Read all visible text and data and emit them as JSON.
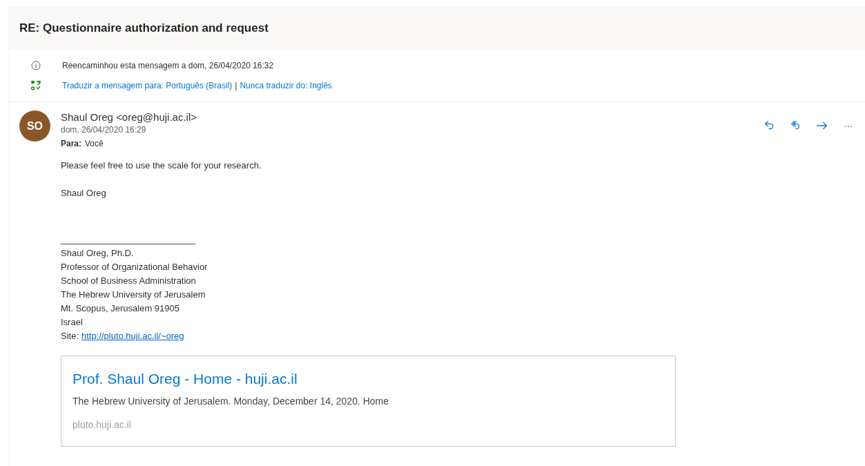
{
  "subject": "RE: Questionnaire authorization and request",
  "notices": [
    {
      "kind": "info",
      "parts": [
        {
          "text": "Reencaminhou esta mensagem a dom, 26/04/2020 16:32",
          "link": false
        }
      ]
    },
    {
      "kind": "translate",
      "parts": [
        {
          "text": "Traduzir a mensagem para: Português (Brasil)",
          "link": true
        },
        {
          "text": "|",
          "link": false
        },
        {
          "text": "Nunca traduzir do: Inglês",
          "link": true
        }
      ]
    }
  ],
  "message": {
    "avatar_initials": "SO",
    "sender": "Shaul Oreg <oreg@huji.ac.il>",
    "date": "dom, 26/04/2020 16:29",
    "to_label": "Para:",
    "to": "Você",
    "actions": [
      {
        "kind": "reply"
      },
      {
        "kind": "reply_all"
      },
      {
        "kind": "forward"
      },
      {
        "kind": "more",
        "text": "···"
      }
    ],
    "paragraphs": [
      "Please feel free to use the scale for your research.",
      "Shaul Oreg"
    ],
    "signature": [
      "___________________________",
      "Shaul Oreg, Ph.D.",
      "Professor of Organizational Behavior",
      "School of Business Administration",
      "The Hebrew University of Jerusalem",
      "Mt. Scopus, Jerusalem 91905",
      "Israel"
    ],
    "site_label": "Site:",
    "site_url": "http://pluto.huji.ac.il/~oreg",
    "preview": {
      "title": "Prof. Shaul Oreg - Home - huji.ac.il",
      "description": "The Hebrew University of Jerusalem. Monday, December 14, 2020. Home",
      "domain": "pluto.huji.ac.il"
    }
  }
}
